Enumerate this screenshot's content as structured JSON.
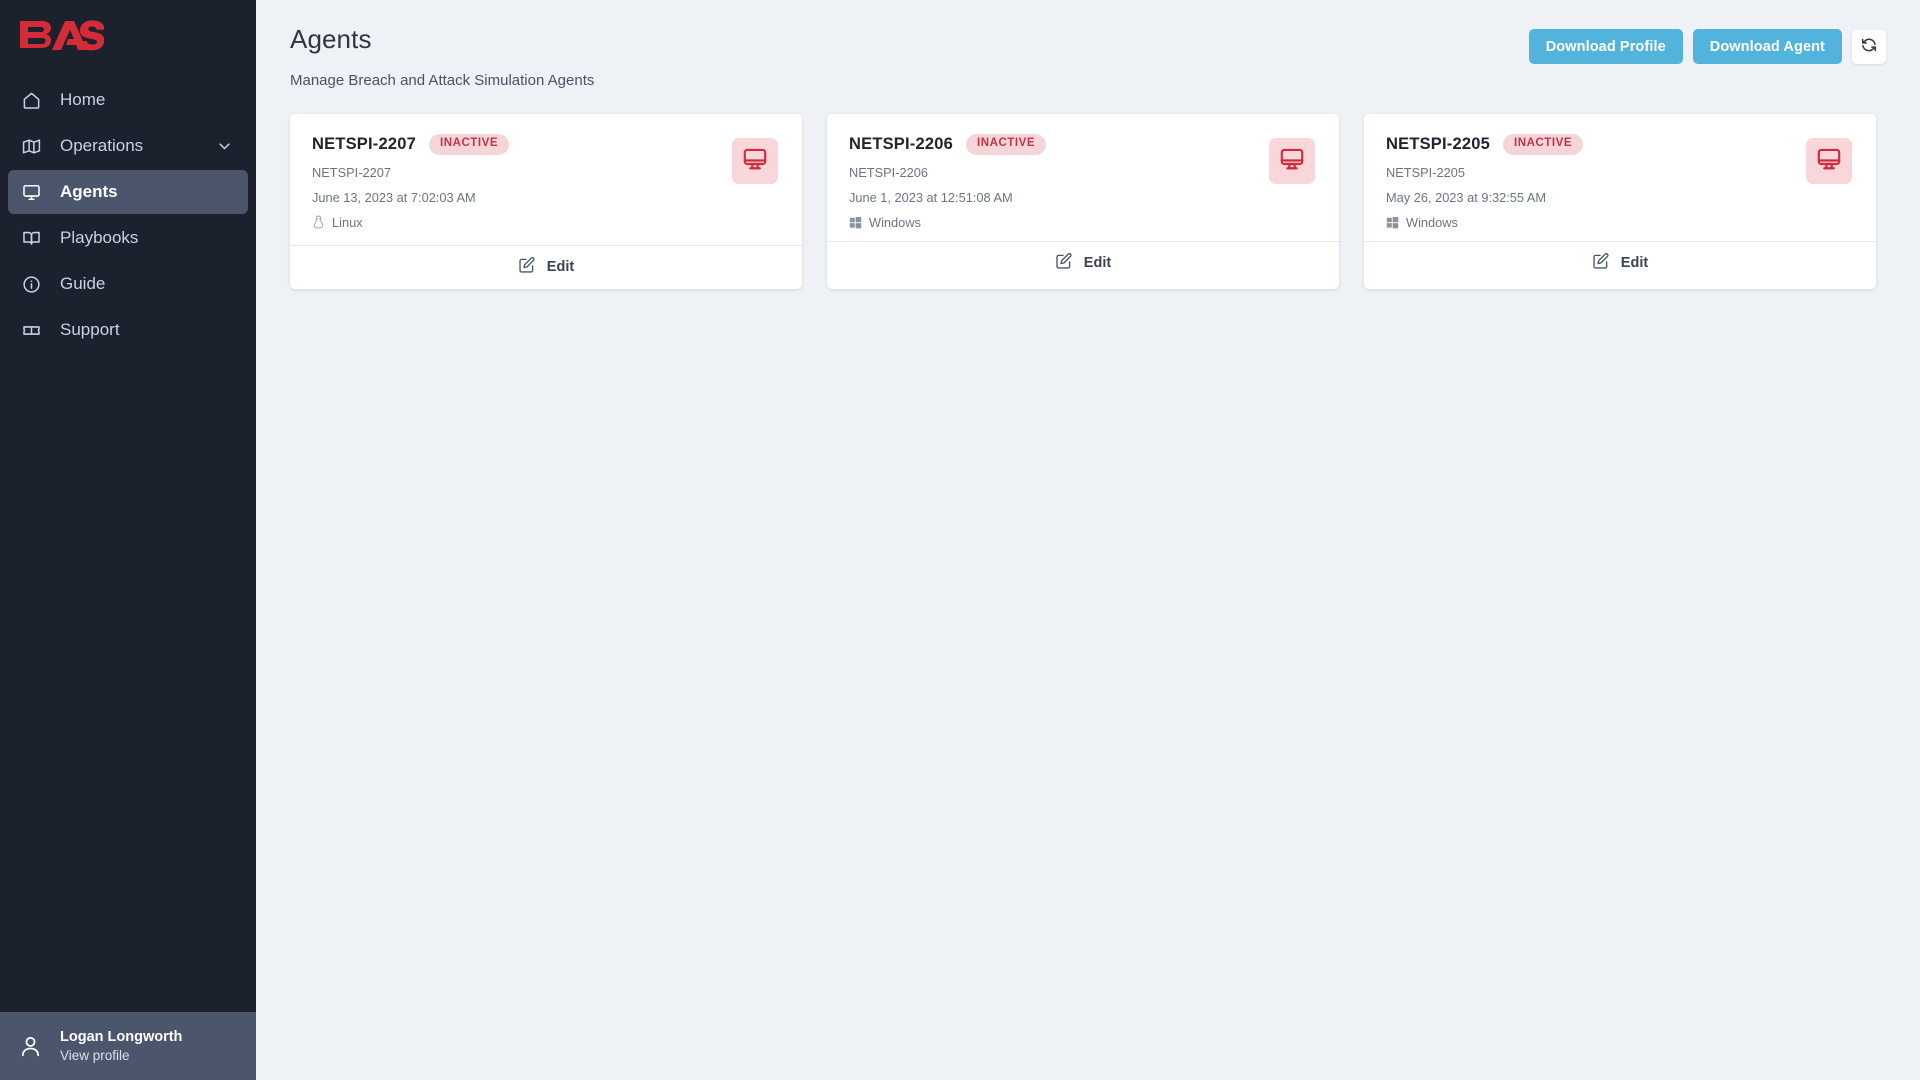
{
  "brand": {
    "logo_text": "BAS",
    "logo_color": "#d32b38"
  },
  "sidebar": {
    "items": [
      {
        "label": "Home",
        "icon": "home-icon",
        "active": false,
        "expandable": false
      },
      {
        "label": "Operations",
        "icon": "map-icon",
        "active": false,
        "expandable": true
      },
      {
        "label": "Agents",
        "icon": "monitor-icon",
        "active": true,
        "expandable": false
      },
      {
        "label": "Playbooks",
        "icon": "book-icon",
        "active": false,
        "expandable": false
      },
      {
        "label": "Guide",
        "icon": "info-circle-icon",
        "active": false,
        "expandable": false
      },
      {
        "label": "Support",
        "icon": "ticket-icon",
        "active": false,
        "expandable": false
      }
    ],
    "footer": {
      "user_name": "Logan Longworth",
      "user_action": "View profile",
      "icon": "user-avatar-icon"
    },
    "active_bg": "#4b556b",
    "bg": "#1c212e"
  },
  "header": {
    "title": "Agents",
    "subtitle": "Manage Breach and Attack Simulation Agents",
    "download_profile_label": "Download Profile",
    "download_agent_label": "Download Agent",
    "refresh_icon": "refresh-sync-icon",
    "button_color": "#52b3dd"
  },
  "agents": [
    {
      "name": "NETSPI-2207",
      "status": "INACTIVE",
      "hostname": "NETSPI-2207",
      "timestamp": "June 13, 2023 at 7:02:03 AM",
      "os": "Linux",
      "os_icon": "linux-penguin-icon",
      "device_icon": "monitor-icon",
      "edit_label": "Edit",
      "compact": false
    },
    {
      "name": "NETSPI-2206",
      "status": "INACTIVE",
      "hostname": "NETSPI-2206",
      "timestamp": "June 1, 2023 at 12:51:08 AM",
      "os": "Windows",
      "os_icon": "windows-logo-icon",
      "device_icon": "monitor-icon",
      "edit_label": "Edit",
      "compact": true
    },
    {
      "name": "NETSPI-2205",
      "status": "INACTIVE",
      "hostname": "NETSPI-2205",
      "timestamp": "May 26, 2023 at 9:32:55 AM",
      "os": "Windows",
      "os_icon": "windows-logo-icon",
      "device_icon": "monitor-icon",
      "edit_label": "Edit",
      "compact": true
    }
  ],
  "colors": {
    "status_badge_bg": "#f6d5d9",
    "status_badge_text": "#c0334a",
    "canvas": "#eef1f5",
    "device_tile": "#f8d6d9",
    "device_icon": "#cf2d3c"
  }
}
